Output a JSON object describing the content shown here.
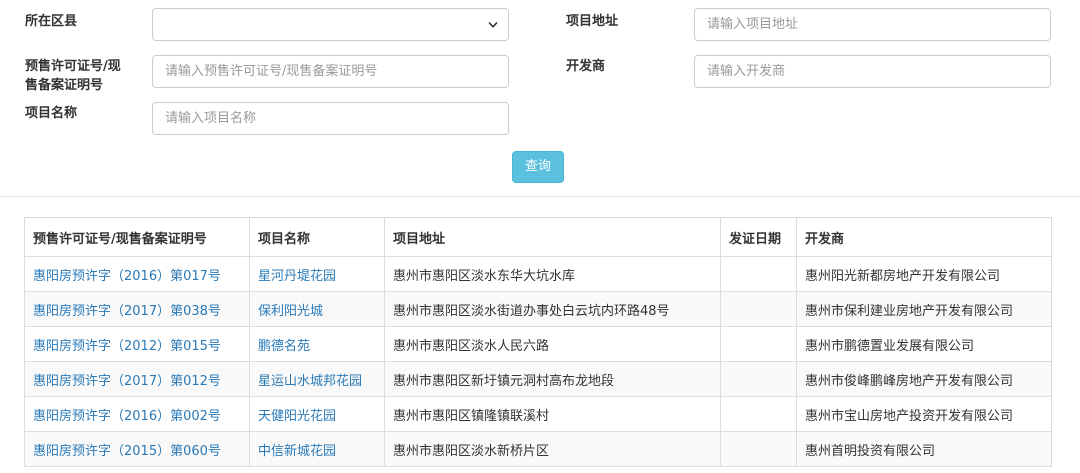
{
  "form": {
    "district_label": "所在区县",
    "district_value": "",
    "address_label": "项目地址",
    "address_placeholder": "请输入项目地址",
    "permit_label_line1": "预售许可证号/现",
    "permit_label_line2": "售备案证明号",
    "permit_placeholder": "请输入预售许可证号/现售备案证明号",
    "developer_label": "开发商",
    "developer_placeholder": "请输入开发商",
    "project_label": "项目名称",
    "project_placeholder": "请输入项目名称",
    "query_button": "查询"
  },
  "table": {
    "headers": [
      "预售许可证号/现售备案证明号",
      "项目名称",
      "项目地址",
      "发证日期",
      "开发商"
    ],
    "rows": [
      {
        "permit": "惠阳房预许字（2016）第017号",
        "name": "星河丹堤花园",
        "address": "惠州市惠阳区淡水东华大坑水库",
        "date": "",
        "developer": "惠州阳光新都房地产开发有限公司"
      },
      {
        "permit": "惠阳房预许字（2017）第038号",
        "name": "保利阳光城",
        "address": "惠州市惠阳区淡水街道办事处白云坑内环路48号",
        "date": "",
        "developer": "惠州市保利建业房地产开发有限公司"
      },
      {
        "permit": "惠阳房预许字（2012）第015号",
        "name": "鹏德名苑",
        "address": "惠州市惠阳区淡水人民六路",
        "date": "",
        "developer": "惠州市鹏德置业发展有限公司"
      },
      {
        "permit": "惠阳房预许字（2017）第012号",
        "name": "星运山水城邦花园",
        "address": "惠州市惠阳区新圩镇元洞村高布龙地段",
        "date": "",
        "developer": "惠州市俊峰鹏峰房地产开发有限公司"
      },
      {
        "permit": "惠阳房预许字（2016）第002号",
        "name": "天健阳光花园",
        "address": "惠州市惠阳区镇隆镇联溪村",
        "date": "",
        "developer": "惠州市宝山房地产投资开发有限公司"
      },
      {
        "permit": "惠阳房预许字（2015）第060号",
        "name": "中信新城花园",
        "address": "惠州市惠阳区淡水新桥片区",
        "date": "",
        "developer": "惠州首明投资有限公司"
      }
    ]
  },
  "colors": {
    "link": "#2a7ab8",
    "button": "#5bc0de"
  },
  "icons": {
    "select_arrow": "chevron-down-icon"
  }
}
